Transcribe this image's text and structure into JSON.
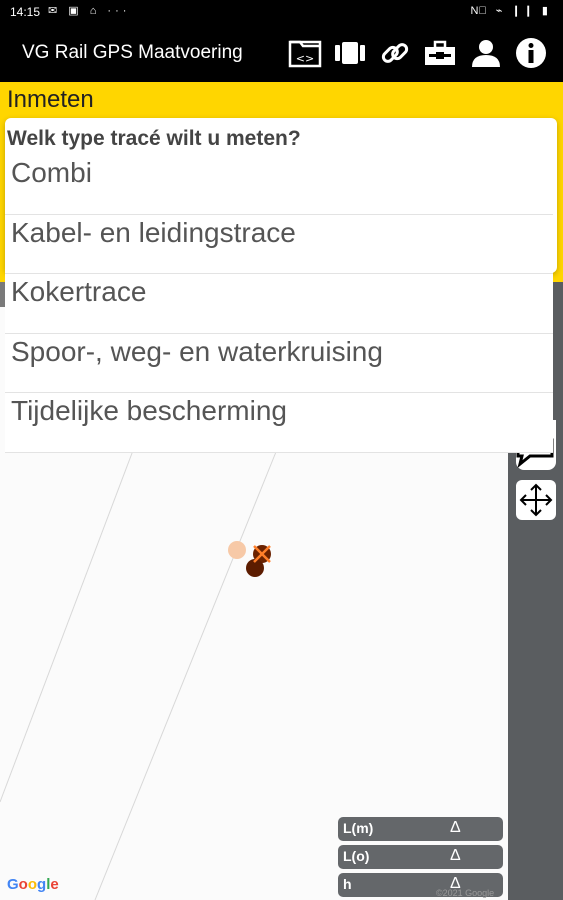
{
  "status_bar": {
    "time": "14:15",
    "left_icons": "✉ ▣ ⌂ ···",
    "right_icons": "N⃥ ⌁ ❙❙ ▮"
  },
  "app_bar": {
    "title": "VG Rail GPS Maatvoering",
    "icons": [
      "folder-code-icon",
      "film-icon",
      "link-icon",
      "toolbox-icon",
      "user-icon",
      "info-icon"
    ]
  },
  "panel": {
    "title": "Inmeten"
  },
  "dialog": {
    "title": "Welk type tracé wilt u meten?",
    "options": [
      "Combi",
      "Kabel- en leidingstrace",
      "Kokertrace",
      "Spoor-, weg- en waterkruising",
      "Tijdelijke bescherming"
    ]
  },
  "measurements": [
    {
      "label": "L(m)",
      "delta": "Δ"
    },
    {
      "label": "L(o)",
      "delta": "Δ"
    },
    {
      "label": "h",
      "delta": "Δ"
    }
  ],
  "map": {
    "attribution": "Google",
    "copyright": "©2021 Google"
  },
  "colors": {
    "panel": "#FFD600",
    "app_bar": "#000000",
    "side_strip": "#5a5d60"
  }
}
